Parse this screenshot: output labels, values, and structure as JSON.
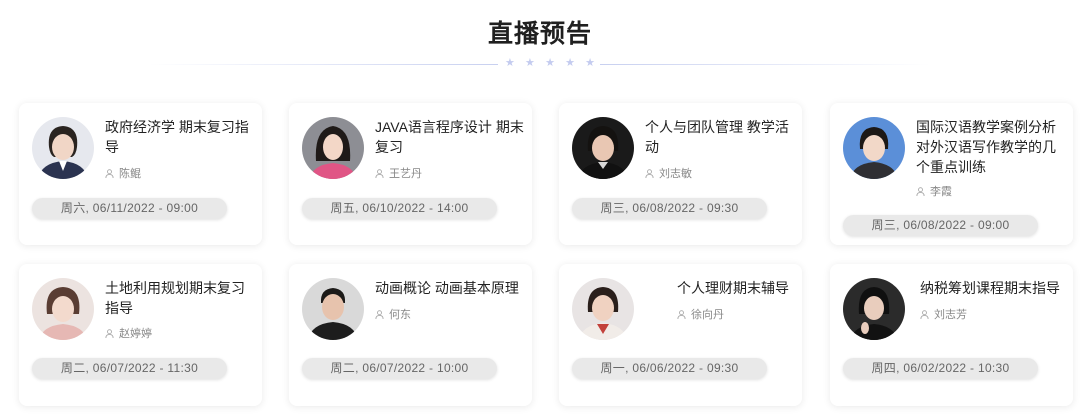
{
  "section_title": "直播预告",
  "cards": [
    {
      "title": "政府经济学 期末复习指导",
      "teacher": "陈鲲",
      "time": "周六, 06/11/2022 - 09:00"
    },
    {
      "title": "JAVA语言程序设计 期末复习",
      "teacher": "王艺丹",
      "time": "周五, 06/10/2022 - 14:00"
    },
    {
      "title": "个人与团队管理 教学活动",
      "teacher": "刘志敏",
      "time": "周三, 06/08/2022 - 09:30"
    },
    {
      "title": "国际汉语教学案例分析对外汉语写作教学的几个重点训练",
      "teacher": "李霞",
      "time": "周三, 06/08/2022 - 09:00"
    },
    {
      "title": "土地利用规划期末复习指导",
      "teacher": "赵婷婷",
      "time": "周二, 06/07/2022 - 11:30"
    },
    {
      "title": "动画概论 动画基本原理",
      "teacher": "何东",
      "time": "周二, 06/07/2022 - 10:00"
    },
    {
      "title": "个人理财期末辅导",
      "teacher": "徐向丹",
      "time": "周一, 06/06/2022 - 09:30"
    },
    {
      "title": "纳税筹划课程期末指导",
      "teacher": "刘志芳",
      "time": "周四, 06/02/2022 - 10:30"
    }
  ],
  "icons": {
    "divider": "star-icon",
    "teacher": "person-icon"
  },
  "colors": {
    "divider_star": "#c3cbef",
    "time_pill_bg": "#e9e9e9"
  }
}
